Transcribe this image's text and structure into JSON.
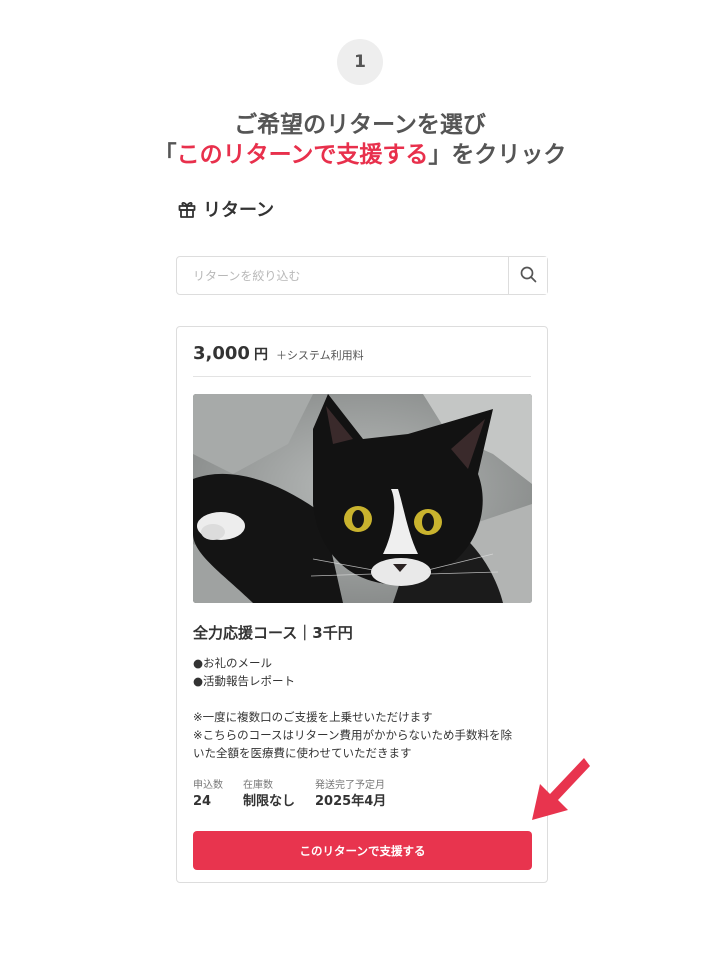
{
  "step": {
    "number": "1"
  },
  "instruction": {
    "line1": "ご希望のリターンを選び",
    "line2_prefix": "「",
    "line2_highlight": "このリターンで支援する",
    "line2_suffix": "」をクリック"
  },
  "section": {
    "title": "リターン",
    "icon": "gift-icon"
  },
  "search": {
    "placeholder": "リターンを絞り込む",
    "value": "",
    "icon": "search-icon"
  },
  "card": {
    "price_amount": "3,000",
    "price_unit": "円",
    "price_note": "＋システム利用料",
    "image": {
      "subject": "black-and-white-cat-photo"
    },
    "course_title": "全力応援コース｜3千円",
    "items": [
      "●お礼のメール",
      "●活動報告レポート"
    ],
    "notes": [
      "※一度に複数口のご支援を上乗せいただけます",
      "※こちらのコースはリターン費用がかからないため手数料を除",
      "いた全額を医療費に使わせていただきます"
    ],
    "stats": [
      {
        "label": "申込数",
        "value": "24"
      },
      {
        "label": "在庫数",
        "value": "制限なし"
      },
      {
        "label": "発送完了予定月",
        "value": "2025年4月"
      }
    ],
    "button_label": "このリターンで支援する"
  },
  "colors": {
    "accent": "#e8344e",
    "highlight_text": "#e8304c",
    "arrow": "#e8344e"
  },
  "annotation": {
    "icon": "pointer-arrow-icon"
  }
}
